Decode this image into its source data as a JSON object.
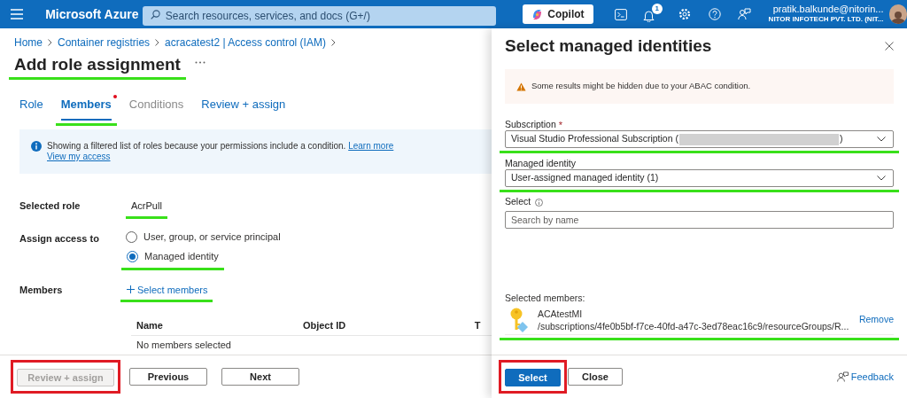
{
  "top_bar": {
    "brand": "Microsoft Azure",
    "search_placeholder": "Search resources, services, and docs (G+/)",
    "copilot": "Copilot",
    "notification_count": "1",
    "user": "pratik.balkunde@nitorin...",
    "tenant": "NITOR INFOTECH PVT. LTD. (NIT..."
  },
  "breadcrumb": [
    "Home",
    "Container registries",
    "acracatest2 | Access control (IAM)"
  ],
  "title": {
    "text": "Add role assignment",
    "underlined": true
  },
  "tabs": [
    {
      "label": "Role",
      "selected": false,
      "disabled": false,
      "required": false
    },
    {
      "label": "Members",
      "selected": true,
      "disabled": false,
      "required": true,
      "underlined": true
    },
    {
      "label": "Conditions",
      "selected": false,
      "disabled": true,
      "required": false
    },
    {
      "label": "Review + assign",
      "selected": false,
      "disabled": false,
      "required": false
    }
  ],
  "info_banner": {
    "text": "Showing a filtered list of roles because your permissions include a condition.",
    "links": [
      "Learn more",
      "View my access"
    ]
  },
  "selected_role": {
    "label": "Selected role",
    "value": "AcrPull",
    "underlined": true
  },
  "assign_access": {
    "label": "Assign access to",
    "options": [
      {
        "label": "User, group, or service principal",
        "selected": false
      },
      {
        "label": "Managed identity",
        "selected": true,
        "underlined": true
      }
    ]
  },
  "members": {
    "label": "Members",
    "link": "Select members",
    "underlined": true
  },
  "members_table": {
    "columns": [
      "Name",
      "Object ID",
      "T"
    ],
    "empty_text": "No members selected"
  },
  "footer_buttons": [
    {
      "label": "Review + assign",
      "disabled": true,
      "framed": true
    },
    {
      "label": "Previous",
      "disabled": false
    },
    {
      "label": "Next",
      "disabled": false
    }
  ],
  "panel": {
    "title": "Select managed identities",
    "warning": "Some results might be hidden due to your ABAC condition.",
    "subscription": {
      "label": "Subscription",
      "required_mark": "*",
      "value_start": "Visual Studio Professional Subscription (",
      "value_end": ")",
      "redacted": true,
      "underlined": true
    },
    "managed_identity": {
      "label": "Managed identity",
      "value": "User-assigned managed identity (1)",
      "underlined": true
    },
    "select": {
      "label": "Select",
      "placeholder": "Search by name"
    },
    "selected_members": {
      "label": "Selected members:",
      "items": [
        {
          "name": "ACAtestMI",
          "path": "/subscriptions/4fe0b5bf-f7ce-40fd-a47c-3ed78eac16c9/resourceGroups/R...",
          "action": "Remove",
          "underlined": true
        }
      ]
    },
    "buttons": [
      {
        "label": "Select",
        "kind": "primary",
        "framed": true
      },
      {
        "label": "Close",
        "kind": "secondary"
      }
    ],
    "feedback": "Feedback"
  }
}
